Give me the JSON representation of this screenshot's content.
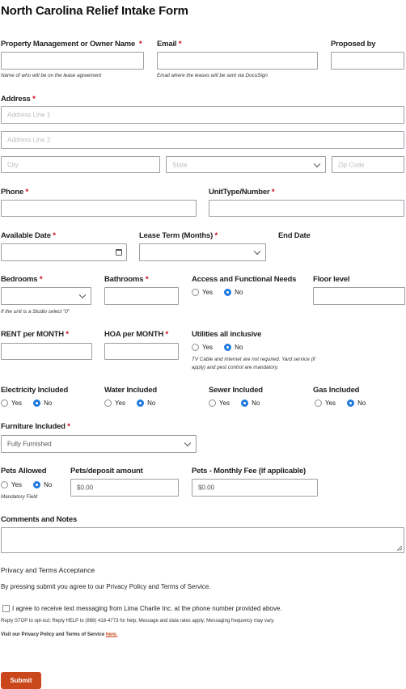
{
  "form_title": "North Carolina Relief Intake Form",
  "fields": {
    "owner": {
      "label": "Property Management or Owner Name",
      "req": "*",
      "help": "Name of who will be on the lease agreement"
    },
    "email": {
      "label": "Email",
      "req": "*",
      "help": "Email where the leases will be sent via DocuSign"
    },
    "proposed_by": {
      "label": "Proposed by"
    },
    "address": {
      "label": "Address",
      "req": "*",
      "line1_placeholder": "Address Line 1",
      "line2_placeholder": "Address Line 2",
      "city_placeholder": "City",
      "state_placeholder": "State",
      "zip_placeholder": "Zip Code"
    },
    "phone": {
      "label": "Phone",
      "req": "*"
    },
    "unit": {
      "label": "UnitType/Number",
      "req": "*"
    },
    "available_date": {
      "label": "Available Date",
      "req": "*"
    },
    "lease_term": {
      "label": "Lease Term (Months)",
      "req": "*"
    },
    "end_date": {
      "label": "End Date"
    },
    "bedrooms": {
      "label": "Bedrooms",
      "req": "*",
      "help": "If  the unit is a Studio select \"0\""
    },
    "bathrooms": {
      "label": "Bathrooms",
      "req": "*"
    },
    "access": {
      "label": "Access and Functional Needs",
      "yes": "Yes",
      "no": "No",
      "selected": "No"
    },
    "floor": {
      "label": "Floor level"
    },
    "rent": {
      "label": "RENT per MONTH",
      "req": "*"
    },
    "hoa": {
      "label": "HOA per MONTH",
      "req": "*"
    },
    "utilities": {
      "label": "Utilities all inclusive",
      "yes": "Yes",
      "no": "No",
      "selected": "No",
      "help": "TV Cable and Internet are not required. Yard service (if apply) and pest control are mandatory."
    },
    "electricity": {
      "label": "Electricity Included",
      "yes": "Yes",
      "no": "No",
      "selected": "No"
    },
    "water": {
      "label": "Water Included",
      "yes": "Yes",
      "no": "No",
      "selected": "No"
    },
    "sewer": {
      "label": "Sewer Included",
      "yes": "Yes",
      "no": "No",
      "selected": "No"
    },
    "gas": {
      "label": "Gas Included",
      "yes": "Yes",
      "no": "No",
      "selected": "No"
    },
    "furniture": {
      "label": "Furniture Included",
      "req": "*",
      "value": "Fully Furnished"
    },
    "pets_allowed": {
      "label": "Pets Allowed",
      "yes": "Yes",
      "no": "No",
      "selected": "No",
      "help": "Mandatory Field"
    },
    "pets_deposit": {
      "label": "Pets/deposit amount",
      "value": "$0.00"
    },
    "pets_fee": {
      "label": "Pets - Monthly Fee (if applicable)",
      "value": "$0.00"
    },
    "comments": {
      "label": "Comments and Notes"
    }
  },
  "privacy": {
    "heading": "Privacy and Terms Acceptance",
    "text": "By pressing submit you agree to our Privacy Policy and Terms of Service.",
    "consent": "I agree to receive text messaging from Lima Charlie Inc. at the phone number provided above.",
    "stop_text": "Reply STOP to opt-out; Reply HELP to (888) 418-4773 for help; Message and data rates apply; Messaging frequency may vary.",
    "visit_text": "Visit our Privacy Policy and Terms of Service",
    "link_text": "here."
  },
  "submit_label": "Submit"
}
